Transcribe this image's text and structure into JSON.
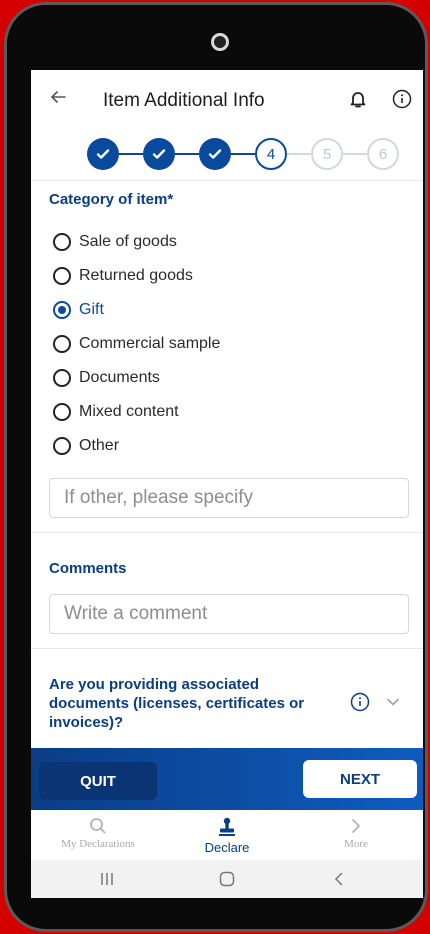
{
  "header": {
    "title": "Item Additional Info",
    "back_icon": "arrow-left-icon",
    "notifications_icon": "bell-icon",
    "info_icon": "info-icon"
  },
  "stepper": {
    "steps": [
      {
        "label": "",
        "state": "done"
      },
      {
        "label": "",
        "state": "done"
      },
      {
        "label": "",
        "state": "done"
      },
      {
        "label": "4",
        "state": "current"
      },
      {
        "label": "5",
        "state": "todo"
      },
      {
        "label": "6",
        "state": "todo"
      }
    ]
  },
  "category": {
    "title": "Category of item*",
    "options": [
      {
        "label": "Sale of goods",
        "selected": false
      },
      {
        "label": "Returned goods",
        "selected": false
      },
      {
        "label": "Gift",
        "selected": true
      },
      {
        "label": "Commercial sample",
        "selected": false
      },
      {
        "label": "Documents",
        "selected": false
      },
      {
        "label": "Mixed content",
        "selected": false
      },
      {
        "label": "Other",
        "selected": false
      }
    ],
    "other_placeholder": "If other, please specify",
    "other_value": ""
  },
  "comments": {
    "title": "Comments",
    "placeholder": "Write a comment",
    "value": ""
  },
  "documents_question": {
    "text": "Are you providing associated documents (licenses, certificates or invoices)?"
  },
  "actions": {
    "quit_label": "QUIT",
    "next_label": "NEXT"
  },
  "tabbar": {
    "items": [
      {
        "label": "My Declarations",
        "icon": "search-icon",
        "active": false
      },
      {
        "label": "Declare",
        "icon": "stamp-icon",
        "active": true
      },
      {
        "label": "More",
        "icon": "chevron-right-icon",
        "active": false
      }
    ]
  },
  "colors": {
    "primary": "#0a4a9c",
    "heading": "#0a3e82",
    "action_bar_start": "#0a3d86",
    "action_bar_end": "#0f5cc0",
    "phone_background": "#d40000"
  }
}
